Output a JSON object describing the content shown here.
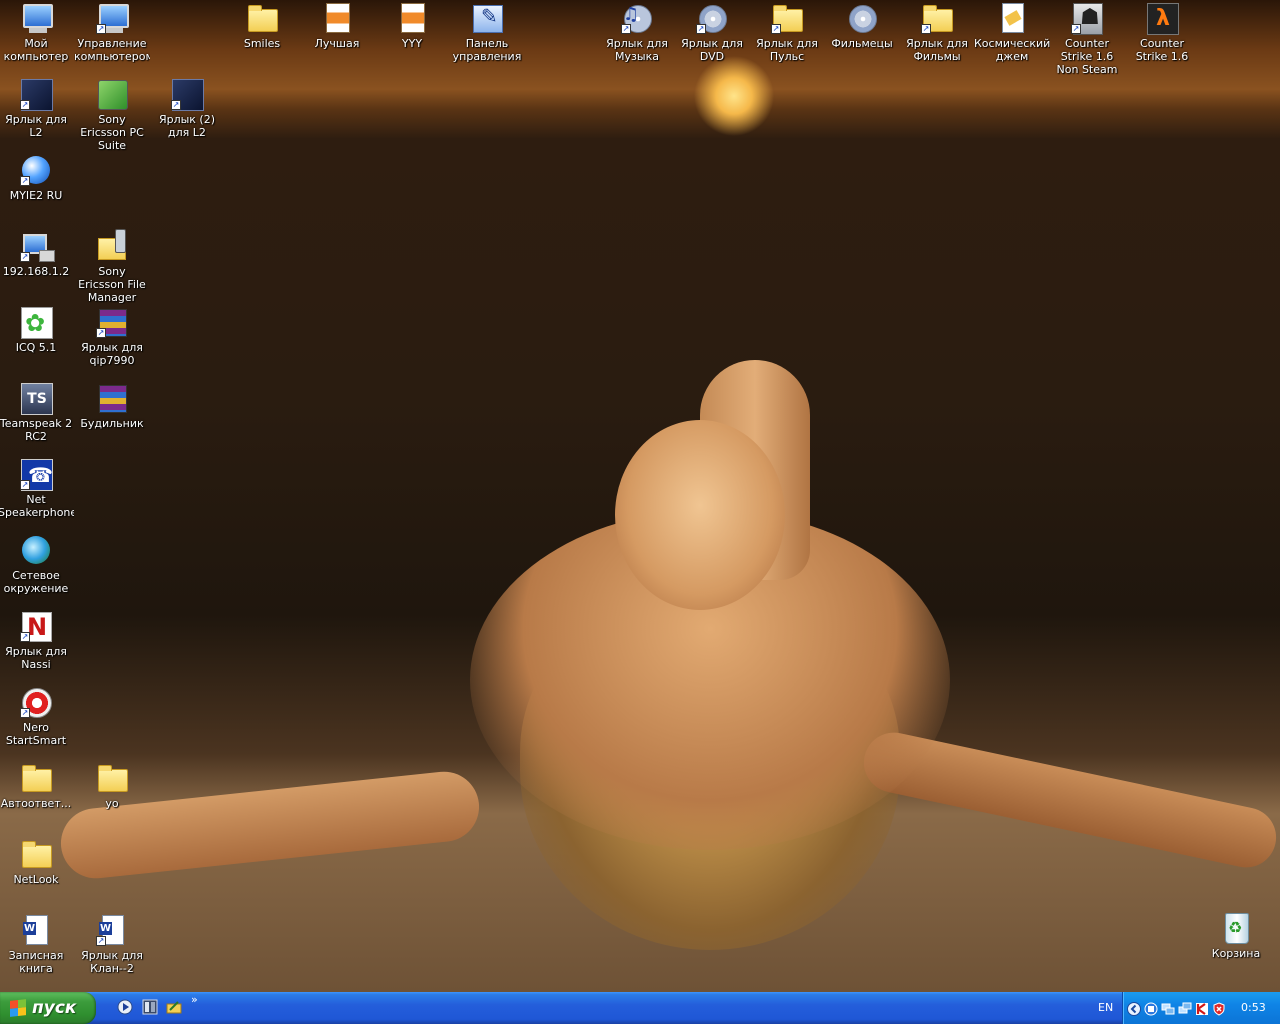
{
  "desktop": {
    "icons": [
      {
        "label": "Мой компьютер",
        "icon": "my-computer-icon"
      },
      {
        "label": "Управление компьютером",
        "icon": "computer-management-icon"
      },
      {
        "label": "Smiles",
        "icon": "folder-icon"
      },
      {
        "label": "Лучшая",
        "icon": "image-file-icon"
      },
      {
        "label": "YYY",
        "icon": "image-file-icon"
      },
      {
        "label": "Панель управления",
        "icon": "control-panel-icon"
      },
      {
        "label": "Ярлык для Музыка",
        "icon": "music-icon"
      },
      {
        "label": "Ярлык для DVD",
        "icon": "dvd-drive-icon"
      },
      {
        "label": "Ярлык для Пульс",
        "icon": "folder-icon"
      },
      {
        "label": "Фильмецы",
        "icon": "cd-drive-icon"
      },
      {
        "label": "Ярлык для Фильмы",
        "icon": "folder-icon"
      },
      {
        "label": "Космический джем",
        "icon": "media-file-icon"
      },
      {
        "label": "Counter Strike 1.6 Non Steam",
        "icon": "counter-strike-icon"
      },
      {
        "label": "Counter Strike 1.6",
        "icon": "half-life-icon"
      },
      {
        "label": "Ярлык для L2",
        "icon": "lineage-icon"
      },
      {
        "label": "Sony Ericsson PC Suite",
        "icon": "sony-ericsson-pc-suite-icon"
      },
      {
        "label": "Ярлык (2) для L2",
        "icon": "lineage-icon"
      },
      {
        "label": "MYIE2 RU",
        "icon": "myie2-browser-icon"
      },
      {
        "label": "192.168.1.2",
        "icon": "network-computer-icon"
      },
      {
        "label": "Sony Ericsson File Manager",
        "icon": "phone-folder-icon"
      },
      {
        "label": "ICQ 5.1",
        "icon": "icq-flower-icon"
      },
      {
        "label": "Ярлык для qip7990",
        "icon": "winrar-archive-icon"
      },
      {
        "label": "Teamspeak 2 RC2",
        "icon": "teamspeak-icon"
      },
      {
        "label": "Будильник",
        "icon": "winrar-archive-icon"
      },
      {
        "label": "Net Speakerphone",
        "icon": "phone-icon"
      },
      {
        "label": "Сетевое окружение",
        "icon": "network-places-icon"
      },
      {
        "label": "Ярлык для Nassi",
        "icon": "nassi-icon"
      },
      {
        "label": "Nero StartSmart",
        "icon": "nero-icon"
      },
      {
        "label": "Автоответ...",
        "icon": "folder-icon"
      },
      {
        "label": "yo",
        "icon": "folder-icon"
      },
      {
        "label": "NetLook",
        "icon": "folder-icon"
      },
      {
        "label": "Записная книга",
        "icon": "word-document-icon"
      },
      {
        "label": "Ярлык для Клан--2",
        "icon": "word-document-icon"
      },
      {
        "label": "Корзина",
        "icon": "recycle-bin-icon"
      }
    ]
  },
  "taskbar": {
    "start_label": "пуск",
    "quick_launch": [
      "media-player-icon",
      "desktop-tiles-icon",
      "folder-arrow-icon"
    ],
    "quick_launch_more": "»",
    "language": "EN",
    "tray_icons": [
      "tray-expand-icon",
      "myie-tray-icon",
      "network-tray-icon",
      "network-tray-icon-2",
      "antivirus-tray-icon",
      "shield-tray-icon"
    ],
    "clock": "0:53"
  },
  "colors": {
    "taskbar_blue": "#245edb",
    "start_green": "#3c9c3c",
    "tray_blue": "#0f84e6"
  }
}
